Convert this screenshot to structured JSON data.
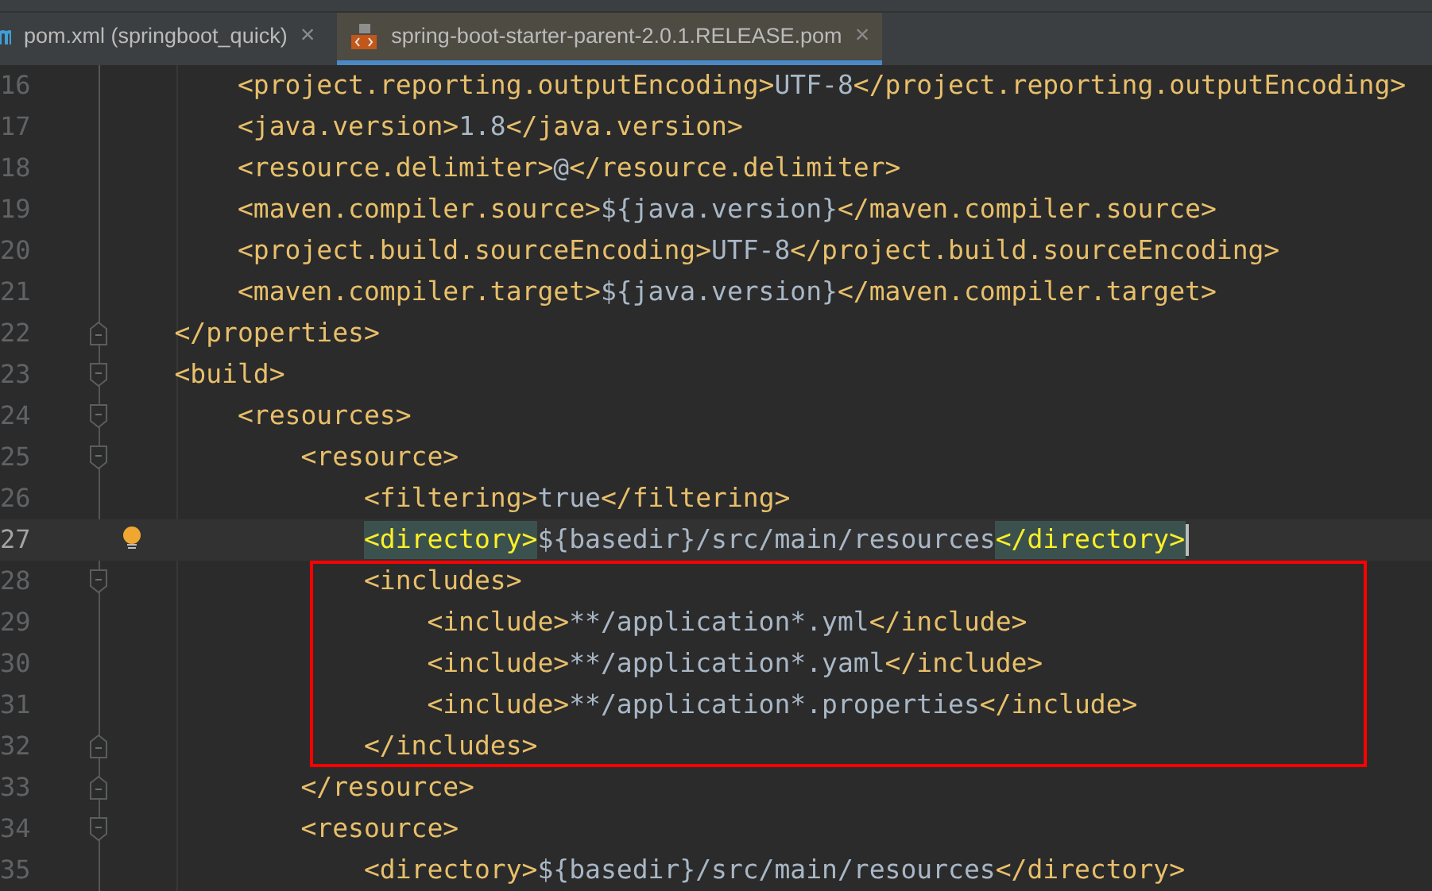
{
  "tabs": [
    {
      "label": "pom.xml (springboot_quick)",
      "close": "×",
      "kind": "maven",
      "selected": false
    },
    {
      "label": "spring-boot-starter-parent-2.0.1.RELEASE.pom",
      "close": "×",
      "kind": "xml",
      "selected": true
    }
  ],
  "lines": [
    {
      "number": "16",
      "current": false,
      "fold_start": false,
      "fold_end": false,
      "bulb": false,
      "boxed": false,
      "segments": [
        {
          "kind": "tag",
          "text": "        <project.reporting.outputEncoding>",
          "matched": false
        },
        {
          "kind": "text",
          "text": "UTF-8"
        },
        {
          "kind": "tag",
          "text": "</project.reporting.outputEncoding>",
          "matched": false
        }
      ]
    },
    {
      "number": "17",
      "current": false,
      "fold_start": false,
      "fold_end": false,
      "bulb": false,
      "boxed": false,
      "segments": [
        {
          "kind": "tag",
          "text": "        <java.version>",
          "matched": false
        },
        {
          "kind": "text",
          "text": "1.8"
        },
        {
          "kind": "tag",
          "text": "</java.version>",
          "matched": false
        }
      ]
    },
    {
      "number": "18",
      "current": false,
      "fold_start": false,
      "fold_end": false,
      "bulb": false,
      "boxed": false,
      "segments": [
        {
          "kind": "tag",
          "text": "        <resource.delimiter>",
          "matched": false
        },
        {
          "kind": "text",
          "text": "@"
        },
        {
          "kind": "tag",
          "text": "</resource.delimiter>",
          "matched": false
        }
      ]
    },
    {
      "number": "19",
      "current": false,
      "fold_start": false,
      "fold_end": false,
      "bulb": false,
      "boxed": false,
      "segments": [
        {
          "kind": "tag",
          "text": "        <maven.compiler.source>",
          "matched": false
        },
        {
          "kind": "text",
          "text": "${java.version}"
        },
        {
          "kind": "tag",
          "text": "</maven.compiler.source>",
          "matched": false
        }
      ]
    },
    {
      "number": "20",
      "current": false,
      "fold_start": false,
      "fold_end": false,
      "bulb": false,
      "boxed": false,
      "segments": [
        {
          "kind": "tag",
          "text": "        <project.build.sourceEncoding>",
          "matched": false
        },
        {
          "kind": "text",
          "text": "UTF-8"
        },
        {
          "kind": "tag",
          "text": "</project.build.sourceEncoding>",
          "matched": false
        }
      ]
    },
    {
      "number": "21",
      "current": false,
      "fold_start": false,
      "fold_end": false,
      "bulb": false,
      "boxed": false,
      "segments": [
        {
          "kind": "tag",
          "text": "        <maven.compiler.target>",
          "matched": false
        },
        {
          "kind": "text",
          "text": "${java.version}"
        },
        {
          "kind": "tag",
          "text": "</maven.compiler.target>",
          "matched": false
        }
      ]
    },
    {
      "number": "22",
      "current": false,
      "fold_start": false,
      "fold_end": true,
      "bulb": false,
      "boxed": false,
      "segments": [
        {
          "kind": "tag",
          "text": "    </properties>",
          "matched": false
        }
      ]
    },
    {
      "number": "23",
      "current": false,
      "fold_start": true,
      "fold_end": false,
      "bulb": false,
      "boxed": false,
      "segments": [
        {
          "kind": "tag",
          "text": "    <build>",
          "matched": false
        }
      ]
    },
    {
      "number": "24",
      "current": false,
      "fold_start": true,
      "fold_end": false,
      "bulb": false,
      "boxed": false,
      "segments": [
        {
          "kind": "tag",
          "text": "        <resources>",
          "matched": false
        }
      ]
    },
    {
      "number": "25",
      "current": false,
      "fold_start": true,
      "fold_end": false,
      "bulb": false,
      "boxed": false,
      "segments": [
        {
          "kind": "tag",
          "text": "            <resource>",
          "matched": false
        }
      ]
    },
    {
      "number": "26",
      "current": false,
      "fold_start": false,
      "fold_end": false,
      "bulb": false,
      "boxed": false,
      "segments": [
        {
          "kind": "tag",
          "text": "                <filtering>",
          "matched": false
        },
        {
          "kind": "text",
          "text": "true"
        },
        {
          "kind": "tag",
          "text": "</filtering>",
          "matched": false
        }
      ]
    },
    {
      "number": "27",
      "current": true,
      "fold_start": false,
      "fold_end": false,
      "bulb": true,
      "boxed": false,
      "segments": [
        {
          "kind": "tag",
          "text": "                <directory>",
          "matched": true
        },
        {
          "kind": "text",
          "text": "${basedir}/src/main/resources"
        },
        {
          "kind": "tag",
          "text": "</directory>",
          "matched": true
        }
      ]
    },
    {
      "number": "28",
      "current": false,
      "fold_start": true,
      "fold_end": false,
      "bulb": false,
      "boxed": true,
      "segments": [
        {
          "kind": "tag",
          "text": "                <includes>",
          "matched": false
        }
      ]
    },
    {
      "number": "29",
      "current": false,
      "fold_start": false,
      "fold_end": false,
      "bulb": false,
      "boxed": true,
      "segments": [
        {
          "kind": "tag",
          "text": "                    <include>",
          "matched": false
        },
        {
          "kind": "text",
          "text": "**/application*.yml"
        },
        {
          "kind": "tag",
          "text": "</include>",
          "matched": false
        }
      ]
    },
    {
      "number": "30",
      "current": false,
      "fold_start": false,
      "fold_end": false,
      "bulb": false,
      "boxed": true,
      "segments": [
        {
          "kind": "tag",
          "text": "                    <include>",
          "matched": false
        },
        {
          "kind": "text",
          "text": "**/application*.yaml"
        },
        {
          "kind": "tag",
          "text": "</include>",
          "matched": false
        }
      ]
    },
    {
      "number": "31",
      "current": false,
      "fold_start": false,
      "fold_end": false,
      "bulb": false,
      "boxed": true,
      "segments": [
        {
          "kind": "tag",
          "text": "                    <include>",
          "matched": false
        },
        {
          "kind": "text",
          "text": "**/application*.properties"
        },
        {
          "kind": "tag",
          "text": "</include>",
          "matched": false
        }
      ]
    },
    {
      "number": "32",
      "current": false,
      "fold_start": false,
      "fold_end": true,
      "bulb": false,
      "boxed": true,
      "segments": [
        {
          "kind": "tag",
          "text": "                </includes>",
          "matched": false
        }
      ]
    },
    {
      "number": "33",
      "current": false,
      "fold_start": false,
      "fold_end": true,
      "bulb": false,
      "boxed": false,
      "segments": [
        {
          "kind": "tag",
          "text": "            </resource>",
          "matched": false
        }
      ]
    },
    {
      "number": "34",
      "current": false,
      "fold_start": true,
      "fold_end": false,
      "bulb": false,
      "boxed": false,
      "segments": [
        {
          "kind": "tag",
          "text": "            <resource>",
          "matched": false
        }
      ]
    },
    {
      "number": "35",
      "current": false,
      "fold_start": false,
      "fold_end": false,
      "bulb": false,
      "boxed": false,
      "segments": [
        {
          "kind": "tag",
          "text": "                <directory>",
          "matched": false
        },
        {
          "kind": "text",
          "text": "${basedir}/src/main/resources"
        },
        {
          "kind": "tag",
          "text": "</directory>",
          "matched": false
        }
      ]
    }
  ]
}
